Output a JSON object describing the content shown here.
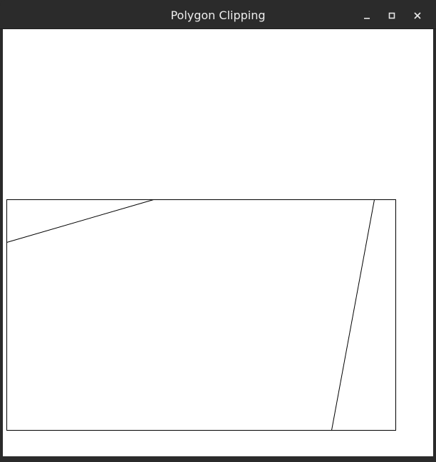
{
  "window": {
    "title": "Polygon Clipping",
    "buttons": {
      "minimize_icon": "minimize-icon",
      "maximize_icon": "maximize-icon",
      "close_icon": "close-icon"
    }
  },
  "colors": {
    "titlebar_bg": "#2b2b2b",
    "title_text": "#eeeeee",
    "canvas_bg": "#ffffff",
    "stroke": "#000000"
  }
}
